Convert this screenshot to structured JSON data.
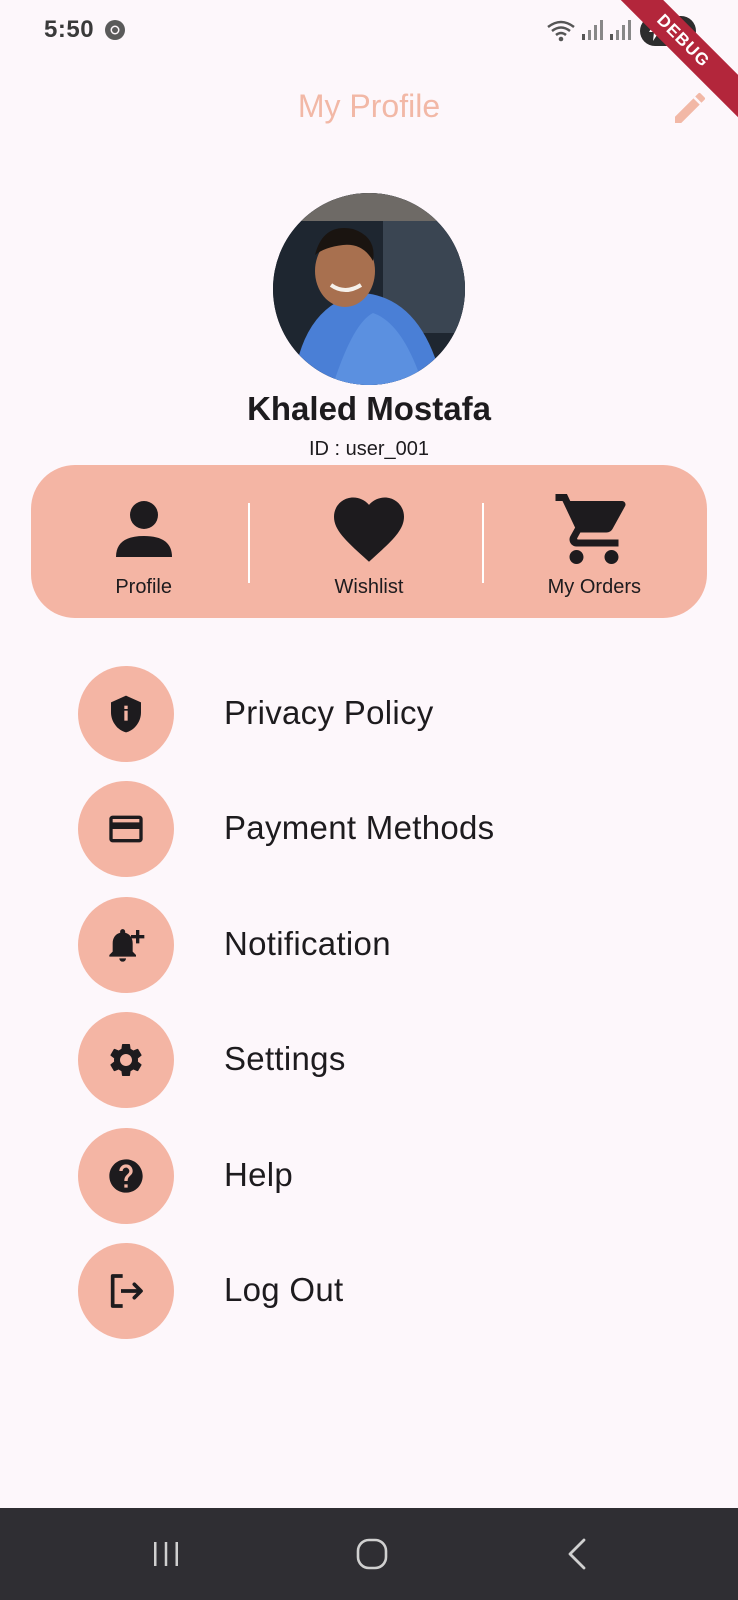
{
  "status_bar": {
    "time": "5:50",
    "battery_level": "40",
    "icons": [
      "chrome-icon",
      "wifi-icon",
      "signal-icon",
      "signal-icon",
      "battery-charging-icon"
    ]
  },
  "debug_banner": "DEBUG",
  "app_bar": {
    "title": "My Profile",
    "edit_icon": "pencil-icon"
  },
  "profile": {
    "name": "Khaled Mostafa",
    "id_text": "ID : user_001"
  },
  "quick_actions": [
    {
      "label": "Profile",
      "icon": "person-icon"
    },
    {
      "label": "Wishlist",
      "icon": "heart-icon"
    },
    {
      "label": "My Orders",
      "icon": "cart-icon"
    }
  ],
  "menu": [
    {
      "label": "Privacy Policy",
      "icon": "shield-icon"
    },
    {
      "label": "Payment Methods",
      "icon": "credit-card-icon"
    },
    {
      "label": "Notification",
      "icon": "bell-add-icon"
    },
    {
      "label": "Settings",
      "icon": "gear-icon"
    },
    {
      "label": "Help",
      "icon": "help-icon"
    },
    {
      "label": "Log Out",
      "icon": "logout-icon"
    }
  ],
  "nav_bar": [
    "recents-icon",
    "home-icon",
    "back-icon"
  ],
  "colors": {
    "background": "#fdf7fb",
    "accent": "#f4b5a4",
    "title": "#f2b8a6",
    "text": "#1d1b1e",
    "nav_bar": "#2f2e33"
  }
}
